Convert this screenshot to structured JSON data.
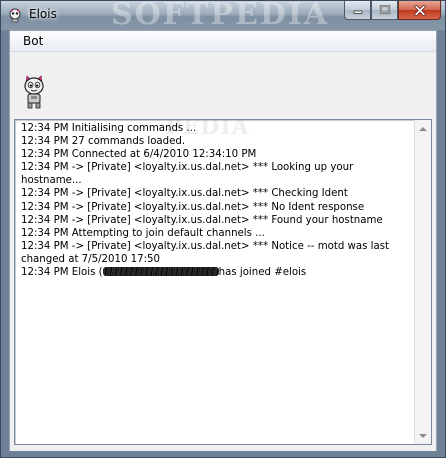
{
  "window": {
    "title": "Elois",
    "watermark": "SOFTPEDIA"
  },
  "caption_buttons": {
    "minimize_icon": "minimize-icon",
    "maximize_icon": "maximize-icon",
    "close_icon": "close-icon"
  },
  "menu": {
    "items": [
      {
        "label": "Bot"
      }
    ]
  },
  "bot": {
    "avatar_icon": "bot-avatar-icon"
  },
  "log": {
    "watermark": "PEDIA",
    "lines": [
      {
        "text": "12:34 PM Initialising commands ..."
      },
      {
        "text": "12:34 PM 27 commands loaded."
      },
      {
        "text": "12:34 PM Connected at 6/4/2010 12:34:10 PM"
      },
      {
        "text": "12:34 PM -> [Private] <loyalty.ix.us.dal.net> *** Looking up your hostname..."
      },
      {
        "text": "12:34 PM -> [Private] <loyalty.ix.us.dal.net> *** Checking Ident"
      },
      {
        "text": "12:34 PM -> [Private] <loyalty.ix.us.dal.net> *** No Ident response"
      },
      {
        "text": "12:34 PM -> [Private] <loyalty.ix.us.dal.net> *** Found your hostname"
      },
      {
        "text": "12:34 PM Attempting to join default channels ..."
      },
      {
        "text": "12:34 PM -> [Private] <loyalty.ix.us.dal.net> *** Notice -- motd was last changed at 7/5/2010 17:50"
      }
    ],
    "join_line": {
      "prefix": "12:34 PM Elois (",
      "suffix": "has joined #elois"
    }
  },
  "colors": {
    "title_bar": "#9aaab9",
    "close_button": "#c0391e",
    "log_background": "#ffffff"
  }
}
